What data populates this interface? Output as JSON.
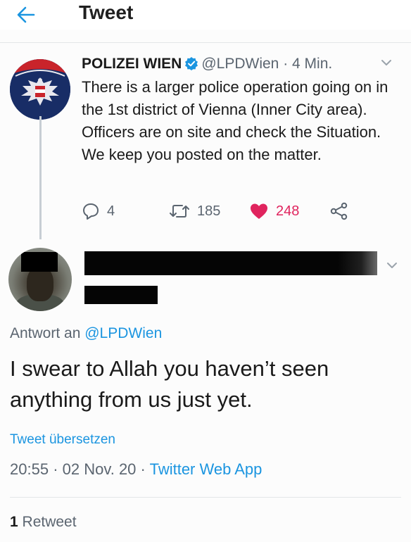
{
  "header": {
    "title": "Tweet"
  },
  "original_tweet": {
    "author_name": "POLIZEI WIEN",
    "handle": "@LPDWien",
    "separator": "·",
    "time": "4 Min.",
    "text": "There is a larger police operation going on in the 1st district of Vienna (Inner City area). Officers are on site and check the Situation. We keep you posted on the matter.",
    "replies": "4",
    "retweets": "185",
    "likes": "248"
  },
  "reply_tweet": {
    "reply_to_label": "Antwort an",
    "reply_to_handle": "@LPDWien",
    "text": "I swear to Allah you haven’t seen anything from us just yet.",
    "translate_link": "Tweet übersetzen",
    "time": "20:55",
    "date": "02 Nov. 20",
    "separator": "·",
    "source": "Twitter Web App",
    "retweet_count": "1",
    "retweet_label": "Retweet"
  },
  "colors": {
    "accent": "#1b95e0",
    "like": "#e0245e",
    "muted": "#5b6570"
  },
  "icons": [
    "back-arrow-icon",
    "verified-badge-icon",
    "chevron-down-icon",
    "reply-icon",
    "retweet-icon",
    "heart-icon",
    "share-icon"
  ]
}
